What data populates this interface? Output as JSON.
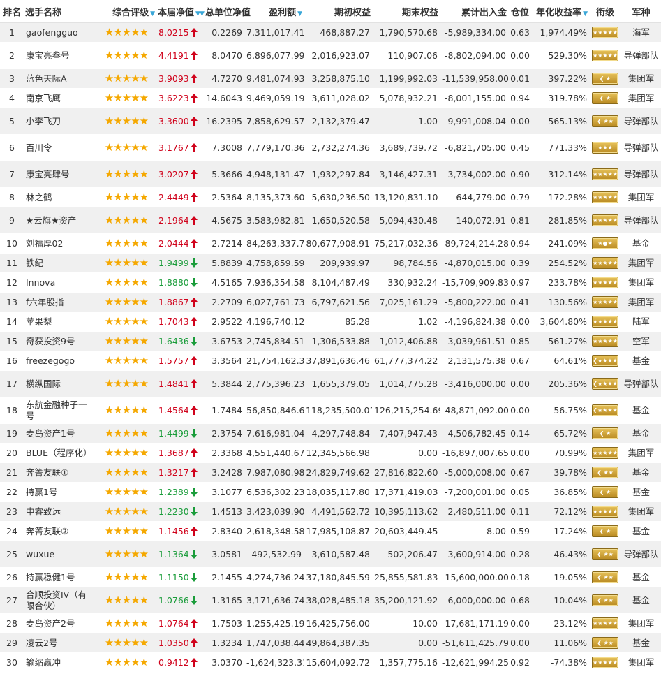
{
  "headers": {
    "rank": "排名",
    "name": "选手名称",
    "rating": "综合评级",
    "nav": "本届净值",
    "unit_nav": "总单位净值",
    "profit": "盈利额",
    "begin_equity": "期初权益",
    "end_equity": "期末权益",
    "net_flow": "累计出入金",
    "position": "仓位",
    "annual": "年化收益率",
    "rank_badge": "衔级",
    "branch": "军种"
  },
  "colors": {
    "up": "#d0021b",
    "down": "#1a9c3a",
    "star": "#f5a800",
    "sort_arrow": "#3aa7d8"
  },
  "rows": [
    {
      "rank": "1",
      "name": "gaofengguo",
      "stars": "★★★★★",
      "nav": "8.0215",
      "dir": "up",
      "unit_nav": "0.2269",
      "profit": "7,311,017.41",
      "begin": "468,887.27",
      "end": "1,790,570.68",
      "flow": "-5,989,334.00",
      "pos": "0.63",
      "annual": "1,974.49%",
      "badge": "★★★★★",
      "branch": "海军"
    },
    {
      "rank": "2",
      "name": "康宝亮叁号",
      "stars": "★★★★★",
      "nav": "4.4191",
      "dir": "up",
      "unit_nav": "8.0470",
      "profit": "6,896,077.99",
      "begin": "2,016,923.07",
      "end": "110,907.06",
      "flow": "-8,802,094.00",
      "pos": "0.00",
      "annual": "529.30%",
      "badge": "★★★★★",
      "branch": "导弹部队"
    },
    {
      "rank": "3",
      "name": "蓝色天际A",
      "stars": "★★★★★",
      "nav": "3.9093",
      "dir": "up",
      "unit_nav": "4.7270",
      "profit": "9,481,074.93",
      "begin": "3,258,875.10",
      "end": "1,199,992.03",
      "flow": "-11,539,958.00",
      "pos": "0.01",
      "annual": "397.22%",
      "badge": "❮ ★",
      "branch": "集团军"
    },
    {
      "rank": "4",
      "name": "南京飞鹰",
      "stars": "★★★★★",
      "nav": "3.6223",
      "dir": "up",
      "unit_nav": "14.6043",
      "profit": "9,469,059.19",
      "begin": "3,611,028.02",
      "end": "5,078,932.21",
      "flow": "-8,001,155.00",
      "pos": "0.94",
      "annual": "319.78%",
      "badge": "❮ ★",
      "branch": "集团军"
    },
    {
      "rank": "5",
      "name": "小李飞刀",
      "stars": "★★★★★",
      "nav": "3.3600",
      "dir": "up",
      "unit_nav": "16.2395",
      "profit": "7,858,629.57",
      "begin": "2,132,379.47",
      "end": "1.00",
      "flow": "-9,991,008.04",
      "pos": "0.00",
      "annual": "565.13%",
      "badge": "❮ ★★",
      "branch": "导弹部队"
    },
    {
      "rank": "6",
      "name": "百川令",
      "stars": "★★★★★",
      "nav": "3.1767",
      "dir": "up",
      "unit_nav": "7.3008",
      "profit": "7,779,170.36",
      "begin": "2,732,274.36",
      "end": "3,689,739.72",
      "flow": "-6,821,705.00",
      "pos": "0.45",
      "annual": "771.33%",
      "badge": "★★★",
      "branch": "导弹部队"
    },
    {
      "rank": "7",
      "name": "康宝亮肆号",
      "stars": "★★★★★",
      "nav": "3.0207",
      "dir": "up",
      "unit_nav": "5.3666",
      "profit": "4,948,131.47",
      "begin": "1,932,297.84",
      "end": "3,146,427.31",
      "flow": "-3,734,002.00",
      "pos": "0.90",
      "annual": "312.14%",
      "badge": "★★★★★",
      "branch": "导弹部队"
    },
    {
      "rank": "8",
      "name": "林之鹤",
      "stars": "★★★★★",
      "nav": "2.4449",
      "dir": "up",
      "unit_nav": "2.5364",
      "profit": "8,135,373.60",
      "begin": "5,630,236.50",
      "end": "13,120,831.10",
      "flow": "-644,779.00",
      "pos": "0.79",
      "annual": "172.28%",
      "badge": "★★★★★",
      "branch": "集团军"
    },
    {
      "rank": "9",
      "name": "★云旗★资产",
      "stars": "★★★★★",
      "nav": "2.1964",
      "dir": "up",
      "unit_nav": "4.5675",
      "profit": "3,583,982.81",
      "begin": "1,650,520.58",
      "end": "5,094,430.48",
      "flow": "-140,072.91",
      "pos": "0.81",
      "annual": "281.85%",
      "badge": "★★★★★",
      "branch": "导弹部队"
    },
    {
      "rank": "10",
      "name": "刘福厚02",
      "stars": "★★★★★",
      "nav": "2.0444",
      "dir": "up",
      "unit_nav": "2.7214",
      "profit": "84,263,337.73",
      "begin": "80,677,908.91",
      "end": "75,217,032.36",
      "flow": "-89,724,214.28",
      "pos": "0.94",
      "annual": "241.09%",
      "badge": "★●★",
      "branch": "基金"
    },
    {
      "rank": "11",
      "name": "铁纪",
      "stars": "★★★★★",
      "nav": "1.9499",
      "dir": "down",
      "unit_nav": "5.8839",
      "profit": "4,758,859.59",
      "begin": "209,939.97",
      "end": "98,784.56",
      "flow": "-4,870,015.00",
      "pos": "0.39",
      "annual": "254.52%",
      "badge": "★★★★★",
      "branch": "集团军"
    },
    {
      "rank": "12",
      "name": "Innova",
      "stars": "★★★★★",
      "nav": "1.8880",
      "dir": "down",
      "unit_nav": "4.5165",
      "profit": "7,936,354.58",
      "begin": "8,104,487.49",
      "end": "330,932.24",
      "flow": "-15,709,909.83",
      "pos": "0.97",
      "annual": "233.78%",
      "badge": "★★★★★",
      "branch": "集团军"
    },
    {
      "rank": "13",
      "name": "f六年股指",
      "stars": "★★★★★",
      "nav": "1.8867",
      "dir": "up",
      "unit_nav": "2.2709",
      "profit": "6,027,761.73",
      "begin": "6,797,621.56",
      "end": "7,025,161.29",
      "flow": "-5,800,222.00",
      "pos": "0.41",
      "annual": "130.56%",
      "badge": "★★★★★",
      "branch": "集团军"
    },
    {
      "rank": "14",
      "name": "苹果梨",
      "stars": "★★★★★",
      "nav": "1.7043",
      "dir": "up",
      "unit_nav": "2.9522",
      "profit": "4,196,740.12",
      "begin": "85.28",
      "end": "1.02",
      "flow": "-4,196,824.38",
      "pos": "0.00",
      "annual": "3,604.80%",
      "badge": "★★★★★",
      "branch": "陆军"
    },
    {
      "rank": "15",
      "name": "奇获投资9号",
      "stars": "★★★★★",
      "nav": "1.6436",
      "dir": "down",
      "unit_nav": "3.6753",
      "profit": "2,745,834.51",
      "begin": "1,306,533.88",
      "end": "1,012,406.88",
      "flow": "-3,039,961.51",
      "pos": "0.85",
      "annual": "561.27%",
      "badge": "★★★★★",
      "branch": "空军"
    },
    {
      "rank": "16",
      "name": "freezegogo",
      "stars": "★★★★★",
      "nav": "1.5757",
      "dir": "up",
      "unit_nav": "3.3564",
      "profit": "21,754,162.38",
      "begin": "37,891,636.46",
      "end": "61,777,374.22",
      "flow": "2,131,575.38",
      "pos": "0.67",
      "annual": "64.61%",
      "badge": "❮★★★★",
      "branch": "基金"
    },
    {
      "rank": "17",
      "name": "横纵国际",
      "stars": "★★★★★",
      "nav": "1.4841",
      "dir": "up",
      "unit_nav": "5.3844",
      "profit": "2,775,396.23",
      "begin": "1,655,379.05",
      "end": "1,014,775.28",
      "flow": "-3,416,000.00",
      "pos": "0.00",
      "annual": "205.36%",
      "badge": "❮★★★★",
      "branch": "导弹部队"
    },
    {
      "rank": "18",
      "name": "东航金融种子一号",
      "stars": "★★★★★",
      "nav": "1.4564",
      "dir": "up",
      "unit_nav": "1.7484",
      "profit": "56,850,846.68",
      "begin": "118,235,500.01",
      "end": "126,215,254.69",
      "flow": "-48,871,092.00",
      "pos": "0.00",
      "annual": "56.75%",
      "badge": "❮★★★★",
      "branch": "基金"
    },
    {
      "rank": "19",
      "name": "麦岛资产1号",
      "stars": "★★★★★",
      "nav": "1.4499",
      "dir": "down",
      "unit_nav": "2.3754",
      "profit": "7,616,981.04",
      "begin": "4,297,748.84",
      "end": "7,407,947.43",
      "flow": "-4,506,782.45",
      "pos": "0.14",
      "annual": "65.72%",
      "badge": "❮ ★",
      "branch": "基金"
    },
    {
      "rank": "20",
      "name": "BLUE（程序化）",
      "stars": "★★★★★",
      "nav": "1.3687",
      "dir": "up",
      "unit_nav": "2.3368",
      "profit": "4,551,440.67",
      "begin": "12,345,566.98",
      "end": "0.00",
      "flow": "-16,897,007.65",
      "pos": "0.00",
      "annual": "70.99%",
      "badge": "★★★★★",
      "branch": "集团军"
    },
    {
      "rank": "21",
      "name": "奔箐友联①",
      "stars": "★★★★★",
      "nav": "1.3217",
      "dir": "up",
      "unit_nav": "3.2428",
      "profit": "7,987,080.98",
      "begin": "24,829,749.62",
      "end": "27,816,822.60",
      "flow": "-5,000,008.00",
      "pos": "0.67",
      "annual": "39.78%",
      "badge": "❮ ★★",
      "branch": "基金"
    },
    {
      "rank": "22",
      "name": "持赢1号",
      "stars": "★★★★★",
      "nav": "1.2389",
      "dir": "down",
      "unit_nav": "3.1077",
      "profit": "6,536,302.23",
      "begin": "18,035,117.80",
      "end": "17,371,419.03",
      "flow": "-7,200,001.00",
      "pos": "0.05",
      "annual": "36.85%",
      "badge": "❮ ★",
      "branch": "基金"
    },
    {
      "rank": "23",
      "name": "中睿致远",
      "stars": "★★★★★",
      "nav": "1.2230",
      "dir": "down",
      "unit_nav": "1.4513",
      "profit": "3,423,039.90",
      "begin": "4,491,562.72",
      "end": "10,395,113.62",
      "flow": "2,480,511.00",
      "pos": "0.11",
      "annual": "72.12%",
      "badge": "★★★★★",
      "branch": "集团军"
    },
    {
      "rank": "24",
      "name": "奔箐友联②",
      "stars": "★★★★★",
      "nav": "1.1456",
      "dir": "up",
      "unit_nav": "2.8340",
      "profit": "2,618,348.58",
      "begin": "17,985,108.87",
      "end": "20,603,449.45",
      "flow": "-8.00",
      "pos": "0.59",
      "annual": "17.24%",
      "badge": "❮ ★",
      "branch": "基金"
    },
    {
      "rank": "25",
      "name": "wuxue",
      "stars": "★★★★★",
      "nav": "1.1364",
      "dir": "down",
      "unit_nav": "3.0581",
      "profit": "492,532.99",
      "begin": "3,610,587.48",
      "end": "502,206.47",
      "flow": "-3,600,914.00",
      "pos": "0.28",
      "annual": "46.43%",
      "badge": "❮ ★★",
      "branch": "导弹部队"
    },
    {
      "rank": "26",
      "name": "持赢稳健1号",
      "stars": "★★★★★",
      "nav": "1.1150",
      "dir": "down",
      "unit_nav": "2.1455",
      "profit": "4,274,736.24",
      "begin": "37,180,845.59",
      "end": "25,855,581.83",
      "flow": "-15,600,000.00",
      "pos": "0.18",
      "annual": "19.05%",
      "badge": "❮ ★★",
      "branch": "基金"
    },
    {
      "rank": "27",
      "name": "合顺投资IV（有限合伙）",
      "stars": "★★★★★",
      "nav": "1.0766",
      "dir": "down",
      "unit_nav": "1.3165",
      "profit": "3,171,636.74",
      "begin": "38,028,485.18",
      "end": "35,200,121.92",
      "flow": "-6,000,000.00",
      "pos": "0.68",
      "annual": "10.04%",
      "badge": "❮ ★★",
      "branch": "基金"
    },
    {
      "rank": "28",
      "name": "麦岛资产2号",
      "stars": "★★★★★",
      "nav": "1.0764",
      "dir": "up",
      "unit_nav": "1.7503",
      "profit": "1,255,425.19",
      "begin": "16,425,756.00",
      "end": "10.00",
      "flow": "-17,681,171.19",
      "pos": "0.00",
      "annual": "23.12%",
      "badge": "★★★★★",
      "branch": "集团军"
    },
    {
      "rank": "29",
      "name": "凌云2号",
      "stars": "★★★★★",
      "nav": "1.0350",
      "dir": "up",
      "unit_nav": "1.3234",
      "profit": "1,747,038.44",
      "begin": "49,864,387.35",
      "end": "0.00",
      "flow": "-51,611,425.79",
      "pos": "0.00",
      "annual": "11.06%",
      "badge": "❮ ★★",
      "branch": "基金"
    },
    {
      "rank": "30",
      "name": "输缩赢冲",
      "stars": "★★★★★",
      "nav": "0.9412",
      "dir": "up",
      "unit_nav": "3.0370",
      "profit": "-1,624,323.31",
      "begin": "15,604,092.72",
      "end": "1,357,775.16",
      "flow": "-12,621,994.25",
      "pos": "0.92",
      "annual": "-74.38%",
      "badge": "★★★★★",
      "branch": "集团军"
    }
  ]
}
